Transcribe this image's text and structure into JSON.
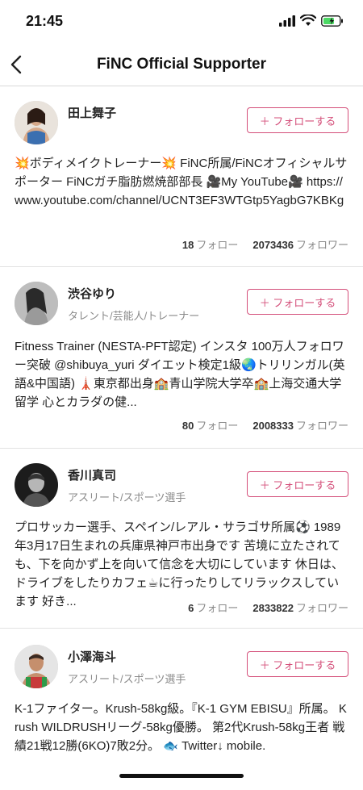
{
  "status_bar": {
    "time": "21:45"
  },
  "header": {
    "title": "FiNC Official Supporter"
  },
  "follow_label": "＋ フォローする",
  "following_suffix": "フォロー",
  "follower_suffix": "フォロワー",
  "accent_color": "#d44f7a",
  "users": [
    {
      "name": "田上舞子",
      "role": "",
      "bio": "💥ボディメイクトレーナー💥 FiNC所属/FiNCオフィシャルサポーター FiNCガチ脂肪燃焼部部長 🎥My YouTube🎥 https://www.youtube.com/channel/UCNT3EF3WTGtp5YagbG7KBKg",
      "following": "18",
      "followers": "2073436"
    },
    {
      "name": "渋谷ゆり",
      "role": "タレント/芸能人/トレーナー",
      "bio": "Fitness Trainer (NESTA-PFT認定) インスタ 100万人フォロワー突破 @shibuya_yuri ダイエット検定1級🌏トリリンガル(英語&中国語) 🗼東京都出身🏫青山学院大学卒🏫上海交通大学留学 心とカラダの健...",
      "following": "80",
      "followers": "2008333"
    },
    {
      "name": "香川真司",
      "role": "アスリート/スポーツ選手",
      "bio": "プロサッカー選手、スペイン/レアル・サラゴサ所属⚽ 1989年3月17日生まれの兵庫県神戸市出身です 苦境に立たされても、下を向かず上を向いて信念を大切にしています 休日は、ドライブをしたりカフェ☕に行ったりしてリラックスしています 好き...",
      "following": "6",
      "followers": "2833822"
    },
    {
      "name": "小澤海斗",
      "role": "アスリート/スポーツ選手",
      "bio": "K-1ファイター。Krush-58kg級。『K-1 GYM EBISU』所属。 Krush WILDRUSHリーグ-58kg優勝。 第2代Krush-58kg王者 戦績21戦12勝(6KO)7敗2分。 🐟 Twitter↓ mobile.",
      "following": "",
      "followers": ""
    }
  ]
}
